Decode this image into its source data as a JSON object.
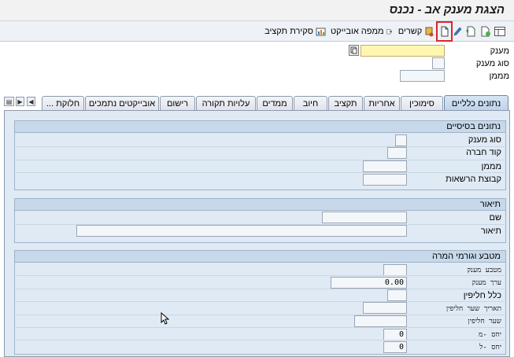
{
  "title": "הצגת מענק אב - נכנס",
  "toolbar": {
    "relations_label": "קשרים",
    "object_map_label": "ממפה אובייקט",
    "budget_close_label": "סקירת תקציב"
  },
  "header": {
    "grant_label": "מענק",
    "grant_type_label": "סוג מענק",
    "sponsor_label": "מממן"
  },
  "tabs": [
    "נתונים כלליים",
    "סימוכין",
    "אחריות",
    "תקציב",
    "חיוב",
    "ממדים",
    "עלויות תקורה",
    "רישום",
    "אובייקטים נתמכים",
    "חלוקת ..."
  ],
  "groups": {
    "basic": {
      "title": "נתונים בסיסיים",
      "fields": [
        "סוג מענק",
        "קוד חברה",
        "מממן",
        "קבוצת הרשאות"
      ]
    },
    "description": {
      "title": "תיאור",
      "fields": [
        "שם",
        "תיאור"
      ]
    },
    "currency": {
      "title": "מטבע וגורמי המרה",
      "fields": [
        "מטבע מענק",
        "ערך מענק",
        "כלל חליפין",
        "תאריך שער חליפין",
        "שער חליפין",
        "יחס -מ",
        "יחס -ל"
      ],
      "grant_value": "0.00",
      "ratio_from": "0",
      "ratio_to": "0"
    }
  }
}
